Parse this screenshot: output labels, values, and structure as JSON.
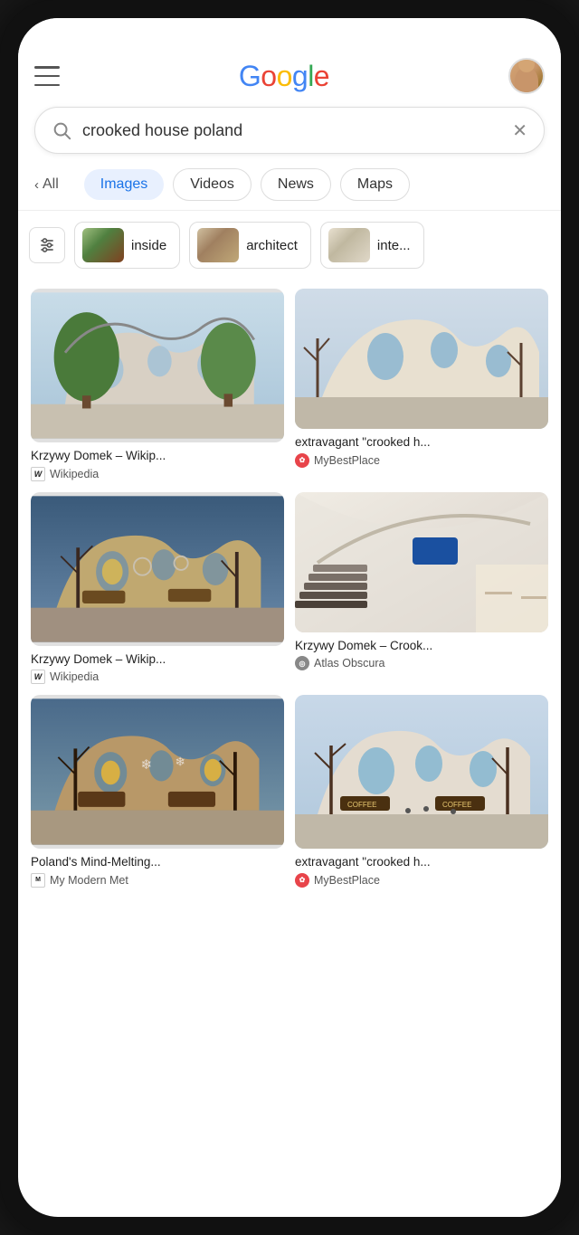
{
  "phone": {
    "search": {
      "query": "crooked house poland",
      "placeholder": "Search"
    },
    "header": {
      "logo": "Google",
      "menu_label": "Main menu",
      "avatar_alt": "User profile"
    },
    "tabs": [
      {
        "label": "All",
        "active": false
      },
      {
        "label": "Images",
        "active": true
      },
      {
        "label": "Videos",
        "active": false
      },
      {
        "label": "News",
        "active": false
      },
      {
        "label": "Maps",
        "active": false
      }
    ],
    "chips": [
      {
        "label": "inside"
      },
      {
        "label": "architect"
      },
      {
        "label": "inte..."
      }
    ],
    "results": [
      {
        "title": "Krzywy Domek – Wikip...",
        "source": "Wikipedia",
        "source_type": "wiki",
        "size": "tall",
        "col": "left"
      },
      {
        "title": "extravagant \"crooked h...",
        "source": "MyBestPlace",
        "source_type": "mybestplace",
        "size": "medium",
        "col": "right"
      },
      {
        "title": "Krzywy Domek – Wikip...",
        "source": "Wikipedia",
        "source_type": "wiki",
        "size": "tall",
        "col": "left"
      },
      {
        "title": "Krzywy Domek – Crook...",
        "source": "Atlas Obscura",
        "source_type": "atlas",
        "size": "medium",
        "col": "right"
      },
      {
        "title": "Poland's Mind-Melting...",
        "source": "My Modern Met",
        "source_type": "modernmet",
        "size": "tall",
        "col": "left"
      },
      {
        "title": "extravagant \"crooked h...",
        "source": "MyBestPlace",
        "source_type": "mybestplace",
        "size": "tall",
        "col": "right"
      }
    ]
  }
}
